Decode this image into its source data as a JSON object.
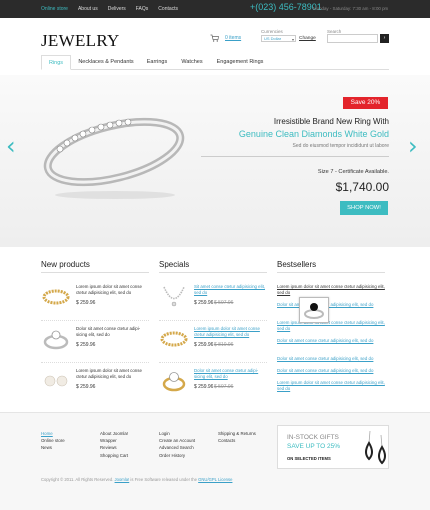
{
  "topbar": {
    "nav": [
      "Online store",
      "About us",
      "Delivers",
      "FAQs",
      "Contacts"
    ],
    "phone": "+(023) 456-78901",
    "hours": "Monday - Saturday: 7:30 am - 8:00 pm"
  },
  "header": {
    "logo": "JEWELRY",
    "cart_items": "0 items",
    "currencies_label": "Currencies",
    "currency_value": "US Dollar",
    "change_label": "Change",
    "search_label": "Search"
  },
  "nav": {
    "tabs": [
      "Rings",
      "Necklaces & Pendants",
      "Earrings",
      "Watches",
      "Engagement Rings"
    ]
  },
  "slider": {
    "badge": "Save 20%",
    "title1": "Irresistible Brand New Ring With",
    "title2": "Genuine Clean Diamonds White Gold",
    "subtitle": "Sed do eiusmod tempor incididunt ut labore",
    "size_text": "Size 7 - Certificate Available.",
    "price": "$1,740.00",
    "button": "SHOP NOW!"
  },
  "columns": {
    "new_products": {
      "title": "New products",
      "items": [
        {
          "name": "Lorem ipsum dolor sit amet conse ctetur adipisicing elit, sed do",
          "price": "$ 259.96",
          "old": ""
        },
        {
          "name": "Dolor sit amet conse ctetur adipi- sicing elit, sed do",
          "price": "$ 259.96",
          "old": ""
        },
        {
          "name": "Lorem ipsum dolor sit amet conse ctetur adipisicing elit, sed do",
          "price": "$ 259.96",
          "old": ""
        }
      ]
    },
    "specials": {
      "title": "Specials",
      "items": [
        {
          "name": "Sit amet conse ctetur adipisicing elit, sed do",
          "price": "$ 259.96",
          "old": "$ 597.96"
        },
        {
          "name": "Lorem ipsum dolor sit amet conse ctetur adipisicing elit, sed do",
          "price": "$ 259.96",
          "old": "$ 810.96"
        },
        {
          "name": "Dolor sit amet conse ctetur adipi- sicing elit, sed do",
          "price": "$ 259.96",
          "old": "$ 597.96"
        }
      ]
    },
    "bestsellers": {
      "title": "Bestsellers",
      "items": [
        "Lorem ipsum dolor sit amet conse ctetur adipisicing elit, sed do",
        "Dolor sit amet conse ctetur adipisicing elit, sed do",
        "Lorem ipsum dolor sit amet conse ctetur adipisicing elit, sed do",
        "Dolor sit amet conse ctetur adipisicing elit, sed do",
        "Dolor sit amet conse ctetur adipisicing elit, sed do",
        "Dolor sit amet conse ctetur adipisicing elit, sed do",
        "Lorem ipsum dolor sit amet conse ctetur adipisicing elit, sed do"
      ]
    }
  },
  "footer": {
    "col1": [
      "Home",
      "Online store",
      "News"
    ],
    "col2": [
      "About Joomla!",
      "Wrapper",
      "Reviews",
      "Shopping Cart"
    ],
    "col3": [
      "Login",
      "Create an Account",
      "Advanced Search",
      "Order History"
    ],
    "col4": [
      "Shipping & Returns",
      "Contacts"
    ],
    "banner": {
      "line1": "IN-STOCK GIFTS",
      "line2": "SAVE UP TO 25%",
      "line3": "ON SELECTED ITEMS"
    },
    "copyright_pre": "Copyright © 2011. All Rights Reserved.",
    "copyright_link1": "Joomla!",
    "copyright_mid": "is Free Software released under the",
    "copyright_link2": "GNU/GPL License"
  },
  "colors": {
    "accent": "#3dbcc1",
    "topbar": "#2b2b2b",
    "sale": "#e3242b",
    "link": "#3aa0c8"
  }
}
